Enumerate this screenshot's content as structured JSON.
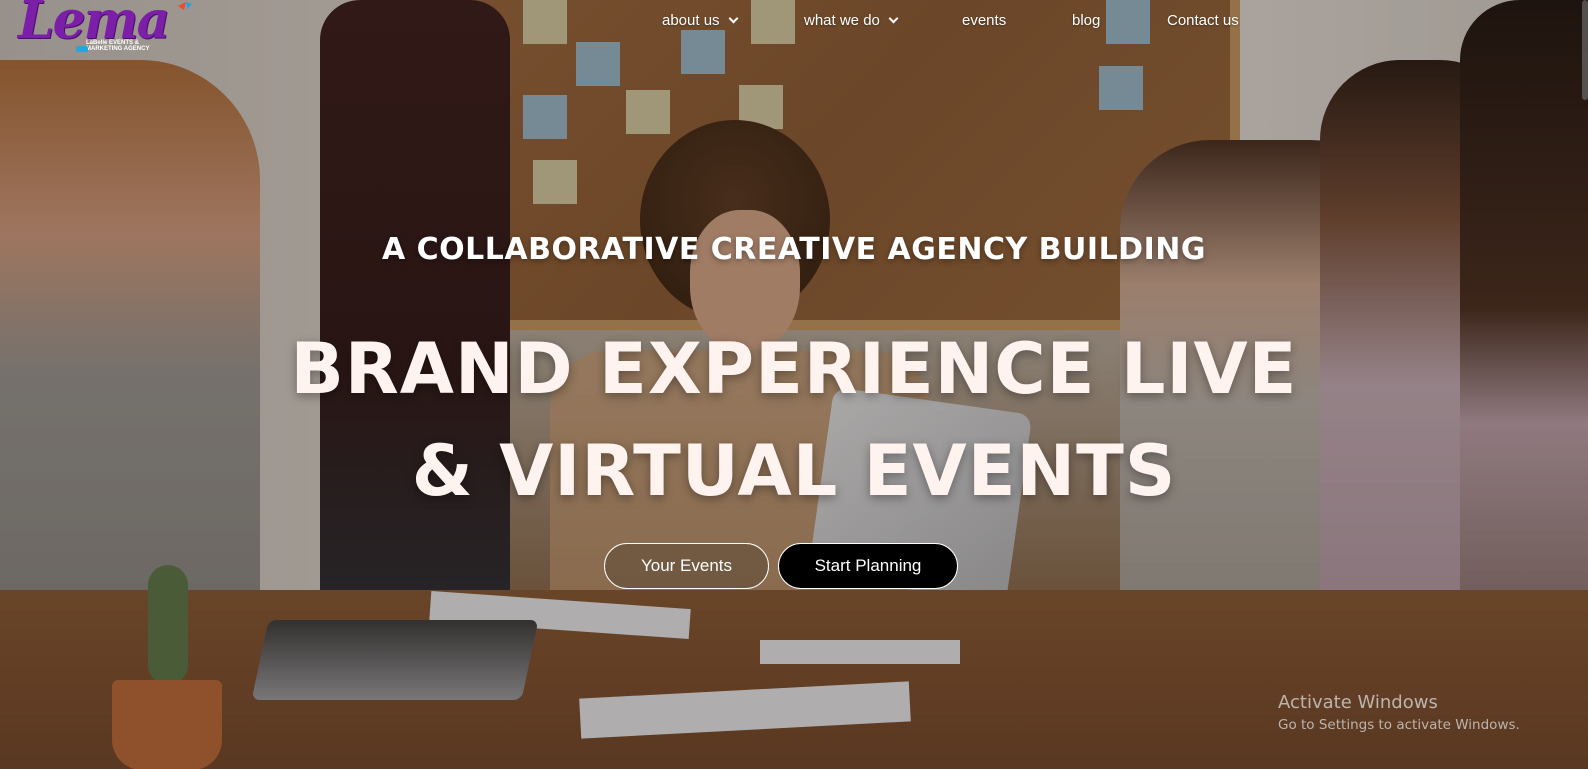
{
  "brand": {
    "logo_text": "Lema",
    "logo_subtext": "LaBelle EVENTS & MARKETING AGENCY"
  },
  "nav": {
    "items": [
      {
        "label": "about us",
        "has_dropdown": true
      },
      {
        "label": "what we do",
        "has_dropdown": true
      },
      {
        "label": "events",
        "has_dropdown": false
      },
      {
        "label": "blog",
        "has_dropdown": false
      },
      {
        "label": "Contact us",
        "has_dropdown": false
      }
    ]
  },
  "hero": {
    "kicker": "A COLLABORATIVE CREATIVE AGENCY BUILDING",
    "title_line1": "BRAND EXPERIENCE LIVE",
    "title_line2": "& VIRTUAL EVENTS",
    "background": "team meeting photo around a wooden table with laptops and corkboard",
    "buttons": {
      "secondary_label": "Your Events",
      "primary_label": "Start Planning"
    }
  },
  "os_overlay": {
    "activate_title": "Activate Windows",
    "activate_subtitle": "Go to Settings to activate Windows."
  },
  "colors": {
    "logo_purple": "#7b1ea8",
    "title_text": "#fff3f0",
    "primary_button_bg": "#000000"
  },
  "icons": [
    "chevron-down-icon"
  ]
}
